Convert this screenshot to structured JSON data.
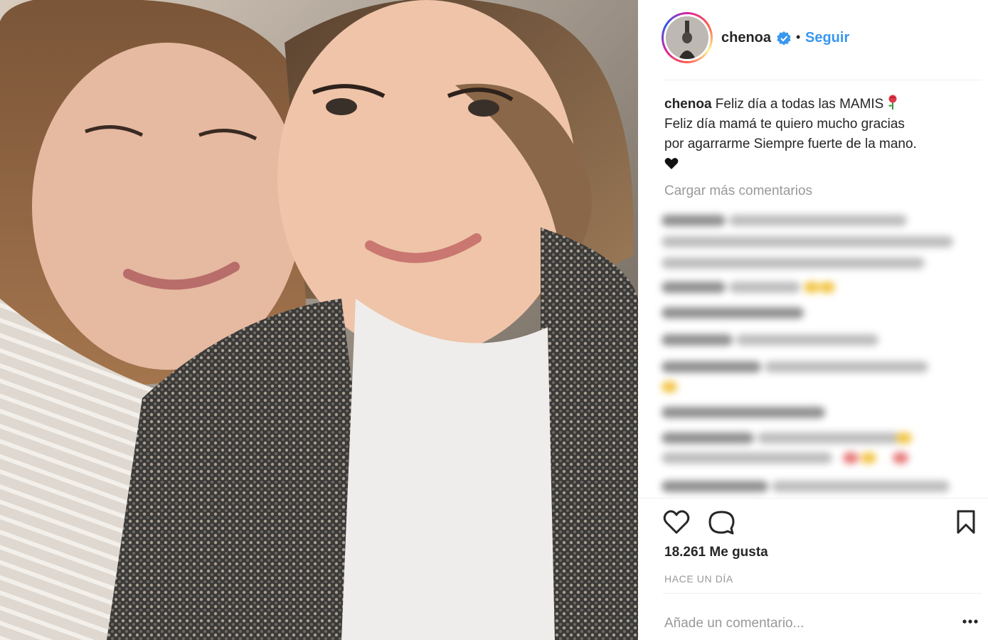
{
  "post": {
    "username": "chenoa",
    "follow_label": "Seguir",
    "separator": "•",
    "caption_user": "chenoa",
    "caption_line1": " Feliz día a todas las MAMIS",
    "caption_line2": "Feliz día mamá te quiero mucho gracias",
    "caption_line3": "por agarrarme Siempre fuerte de la mano.",
    "load_more": "Cargar más comentarios",
    "likes": "18.261 Me gusta",
    "timestamp": "HACE UN DÍA",
    "add_comment_placeholder": "Añade un comentario..."
  },
  "icons": {
    "verified": "verified-badge-icon",
    "rose": "rose-emoji-icon",
    "heart_black": "black-heart-emoji-icon",
    "like": "heart-outline-icon",
    "comment": "speech-bubble-icon",
    "save": "bookmark-icon",
    "more": "ellipsis-icon"
  },
  "colors": {
    "link_blue": "#3897f0",
    "verified_blue": "#3897f0",
    "text": "#262626",
    "muted": "#999999"
  }
}
